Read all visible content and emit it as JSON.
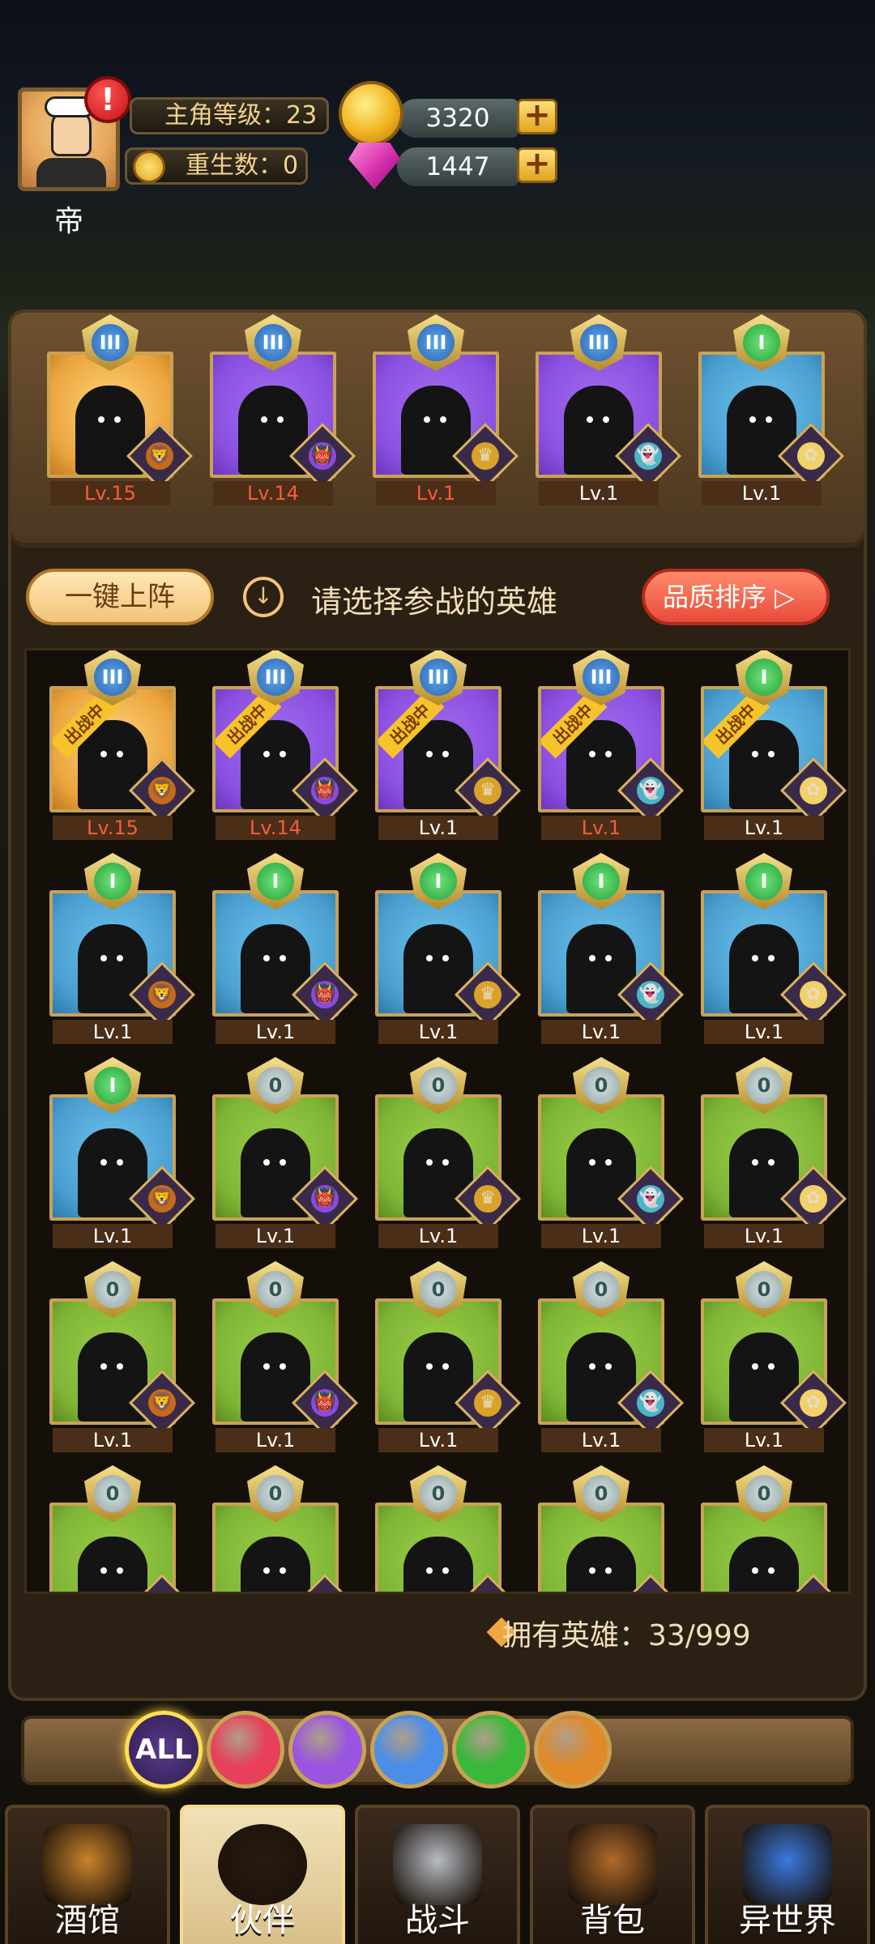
{
  "player": {
    "name": "帝",
    "level_label": "主角等级：23",
    "rebirth_label": "重生数：0",
    "alert": "!"
  },
  "currency": {
    "gold": "3320",
    "gems": "1447",
    "plus": "+"
  },
  "team": [
    {
      "level": "Lv.15",
      "rank": "III",
      "bg": "gold",
      "lv_red": true,
      "class": "lion"
    },
    {
      "level": "Lv.14",
      "rank": "III",
      "bg": "purple",
      "lv_red": true,
      "class": "demon"
    },
    {
      "level": "Lv.1",
      "rank": "III",
      "bg": "purple",
      "lv_red": true,
      "class": "crown"
    },
    {
      "level": "Lv.1",
      "rank": "III",
      "bg": "purple",
      "lv_red": false,
      "class": "ghost"
    },
    {
      "level": "Lv.1",
      "rank": "I",
      "bg": "blue",
      "lv_red": false,
      "class": "fairy"
    }
  ],
  "actions": {
    "one_key": "一键上阵",
    "hint_icon": "↓",
    "hint": "请选择参战的英雄",
    "sort": "品质排序 ▷"
  },
  "deployed_label": "出战中",
  "heroes": [
    {
      "level": "Lv.15",
      "rank": "III",
      "bg": "gold",
      "lv_red": true,
      "deployed": true
    },
    {
      "level": "Lv.14",
      "rank": "III",
      "bg": "purple",
      "lv_red": true,
      "deployed": true
    },
    {
      "level": "Lv.1",
      "rank": "III",
      "bg": "purple",
      "lv_red": false,
      "deployed": true
    },
    {
      "level": "Lv.1",
      "rank": "III",
      "bg": "purple",
      "lv_red": true,
      "deployed": true
    },
    {
      "level": "Lv.1",
      "rank": "I",
      "bg": "blue",
      "lv_red": false,
      "deployed": true
    },
    {
      "level": "Lv.1",
      "rank": "I",
      "bg": "blue",
      "lv_red": false,
      "deployed": false
    },
    {
      "level": "Lv.1",
      "rank": "I",
      "bg": "blue",
      "lv_red": false,
      "deployed": false
    },
    {
      "level": "Lv.1",
      "rank": "I",
      "bg": "blue",
      "lv_red": false,
      "deployed": false
    },
    {
      "level": "Lv.1",
      "rank": "I",
      "bg": "blue",
      "lv_red": false,
      "deployed": false
    },
    {
      "level": "Lv.1",
      "rank": "I",
      "bg": "blue",
      "lv_red": false,
      "deployed": false
    },
    {
      "level": "Lv.1",
      "rank": "I",
      "bg": "blue",
      "lv_red": false,
      "deployed": false
    },
    {
      "level": "Lv.1",
      "rank": "0",
      "bg": "green",
      "lv_red": false,
      "deployed": false
    },
    {
      "level": "Lv.1",
      "rank": "0",
      "bg": "green",
      "lv_red": false,
      "deployed": false
    },
    {
      "level": "Lv.1",
      "rank": "0",
      "bg": "green",
      "lv_red": false,
      "deployed": false
    },
    {
      "level": "Lv.1",
      "rank": "0",
      "bg": "green",
      "lv_red": false,
      "deployed": false
    },
    {
      "level": "Lv.1",
      "rank": "0",
      "bg": "green",
      "lv_red": false,
      "deployed": false
    },
    {
      "level": "Lv.1",
      "rank": "0",
      "bg": "green",
      "lv_red": false,
      "deployed": false
    },
    {
      "level": "Lv.1",
      "rank": "0",
      "bg": "green",
      "lv_red": false,
      "deployed": false
    },
    {
      "level": "Lv.1",
      "rank": "0",
      "bg": "green",
      "lv_red": false,
      "deployed": false
    },
    {
      "level": "Lv.1",
      "rank": "0",
      "bg": "green",
      "lv_red": false,
      "deployed": false
    },
    {
      "level": "",
      "rank": "0",
      "bg": "green",
      "lv_red": false,
      "deployed": false
    },
    {
      "level": "",
      "rank": "0",
      "bg": "green",
      "lv_red": false,
      "deployed": false
    },
    {
      "level": "",
      "rank": "0",
      "bg": "green",
      "lv_red": false,
      "deployed": false
    },
    {
      "level": "",
      "rank": "0",
      "bg": "green",
      "lv_red": false,
      "deployed": false
    },
    {
      "level": "",
      "rank": "0",
      "bg": "green",
      "lv_red": false,
      "deployed": false
    }
  ],
  "owned": "拥有英雄：33/999",
  "filters": [
    {
      "name": "all",
      "label": "ALL",
      "color": "#5a3a8a",
      "active": true
    },
    {
      "name": "warrior",
      "label": "",
      "color": "#e8405a",
      "active": false
    },
    {
      "name": "mage",
      "label": "",
      "color": "#9a55e0",
      "active": false
    },
    {
      "name": "assassin",
      "label": "",
      "color": "#4a8ee8",
      "active": false
    },
    {
      "name": "healer",
      "label": "",
      "color": "#3ab83a",
      "active": false
    },
    {
      "name": "tank",
      "label": "",
      "color": "#e08a2a",
      "active": false
    }
  ],
  "nav": [
    {
      "name": "tavern",
      "label": "酒馆",
      "active": false,
      "icon": "beer-mug-icon"
    },
    {
      "name": "partner",
      "label": "伙伴",
      "active": true,
      "icon": "hero-face-icon"
    },
    {
      "name": "battle",
      "label": "战斗",
      "active": false,
      "icon": "crossed-swords-icon"
    },
    {
      "name": "bag",
      "label": "背包",
      "active": false,
      "icon": "treasure-chest-icon"
    },
    {
      "name": "otherworld",
      "label": "异世界",
      "active": false,
      "icon": "portal-icon"
    }
  ]
}
